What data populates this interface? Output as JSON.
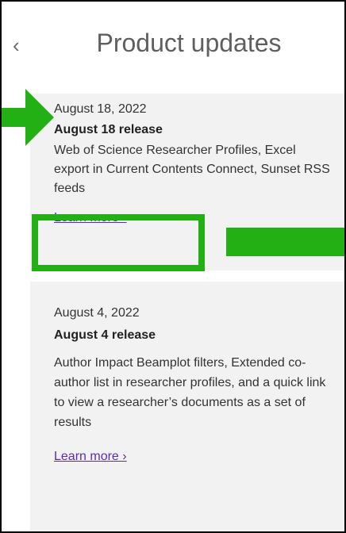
{
  "header": {
    "back_glyph": "‹",
    "title": "Product updates"
  },
  "updates": [
    {
      "date": "August 18, 2022",
      "title": "August 18 release",
      "description": "Web of Science Researcher Profiles, Excel export in Current Contents Connect, Sunset RSS feeds",
      "link_label": "Learn more ›"
    },
    {
      "date": "August 4, 2022",
      "title": "August 4 release",
      "description": "Author Impact Beamplot filters, Extended co-author list in researcher profiles, and a quick link to view a researcher’s documents as a set of results",
      "link_label": "Learn more ›"
    }
  ],
  "colors": {
    "annotation": "#22b014",
    "link": "#5c2bbd",
    "card_background": "#f2f2f2"
  },
  "icons": {
    "back": "chevron-left-icon",
    "annotation_arrow": "arrow-right-icon"
  }
}
